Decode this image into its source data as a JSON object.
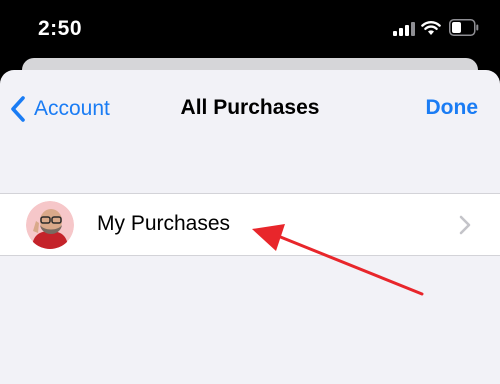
{
  "status_bar": {
    "time": "2:50",
    "icons": [
      "cellular-signal-icon",
      "wifi-icon",
      "battery-icon"
    ]
  },
  "nav": {
    "back_label": "Account",
    "title": "All Purchases",
    "done_label": "Done"
  },
  "list": {
    "items": [
      {
        "label": "My Purchases",
        "icon": "memoji-avatar",
        "accessory": "chevron-right-icon"
      }
    ]
  },
  "colors": {
    "accent": "#1a7cf4",
    "background": "#f2f2f7",
    "annotation": "#e8262b"
  }
}
